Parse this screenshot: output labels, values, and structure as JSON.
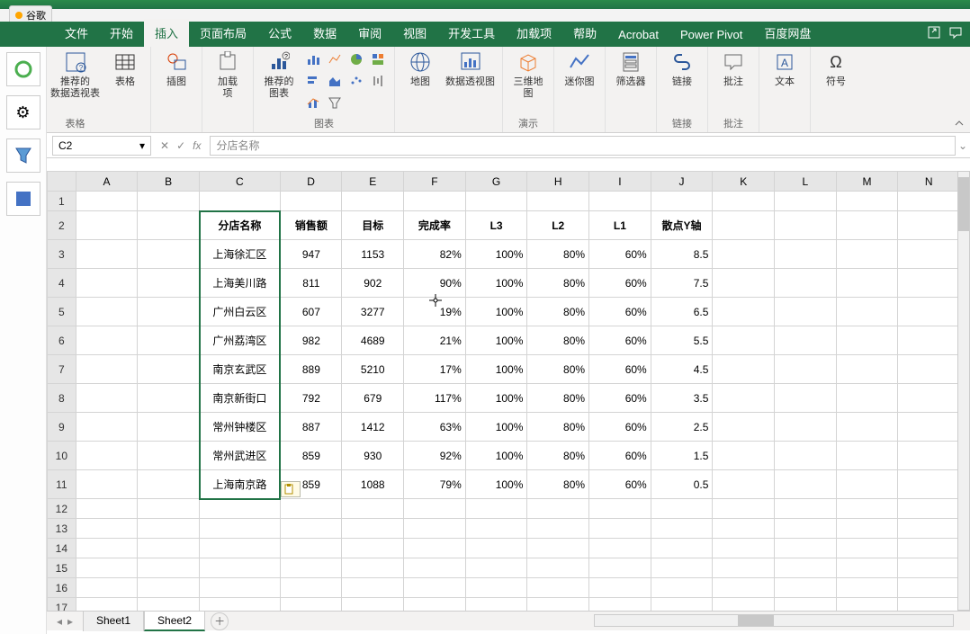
{
  "browser_tab": "谷歌",
  "tabs": [
    "文件",
    "开始",
    "插入",
    "页面布局",
    "公式",
    "数据",
    "审阅",
    "视图",
    "开发工具",
    "加载项",
    "帮助",
    "Acrobat",
    "Power Pivot",
    "百度网盘"
  ],
  "active_tab_index": 2,
  "ribbon": {
    "tables": {
      "pivot": "数据透\n视表",
      "recommend": "推荐的\n数据透视表",
      "table": "表格",
      "group": "表格"
    },
    "illus": {
      "illus": "插图"
    },
    "addins": {
      "addins": "加载\n项"
    },
    "charts": {
      "recommended": "推荐的\n图表",
      "group": "图表"
    },
    "map": {
      "map": "地图",
      "pivotchart": "数据透视图"
    },
    "threed": {
      "label": "三维地\n图",
      "group": "演示"
    },
    "spark": {
      "label": "迷你图"
    },
    "filter": {
      "label": "筛选器"
    },
    "link": {
      "label": "链接",
      "group": "链接"
    },
    "comment": {
      "label": "批注",
      "group": "批注"
    },
    "text": {
      "label": "文本"
    },
    "symbol": {
      "label": "符号"
    }
  },
  "namebox": "C2",
  "formula": "分店名称",
  "columns": [
    "A",
    "B",
    "C",
    "D",
    "E",
    "F",
    "G",
    "H",
    "I",
    "J",
    "K",
    "L",
    "M",
    "N"
  ],
  "headers": {
    "c": "分店名称",
    "d": "销售额",
    "e": "目标",
    "f": "完成率",
    "g": "L3",
    "h": "L2",
    "i": "L1",
    "j": "散点Y轴"
  },
  "rows": [
    {
      "n": "上海徐汇区",
      "d": "947",
      "e": "1153",
      "f": "82%",
      "g": "100%",
      "h": "80%",
      "i": "60%",
      "j": "8.5"
    },
    {
      "n": "上海美川路",
      "d": "811",
      "e": "902",
      "f": "90%",
      "g": "100%",
      "h": "80%",
      "i": "60%",
      "j": "7.5"
    },
    {
      "n": "广州白云区",
      "d": "607",
      "e": "3277",
      "f": "19%",
      "g": "100%",
      "h": "80%",
      "i": "60%",
      "j": "6.5"
    },
    {
      "n": "广州荔湾区",
      "d": "982",
      "e": "4689",
      "f": "21%",
      "g": "100%",
      "h": "80%",
      "i": "60%",
      "j": "5.5"
    },
    {
      "n": "南京玄武区",
      "d": "889",
      "e": "5210",
      "f": "17%",
      "g": "100%",
      "h": "80%",
      "i": "60%",
      "j": "4.5"
    },
    {
      "n": "南京新街口",
      "d": "792",
      "e": "679",
      "f": "117%",
      "g": "100%",
      "h": "80%",
      "i": "60%",
      "j": "3.5"
    },
    {
      "n": "常州钟楼区",
      "d": "887",
      "e": "1412",
      "f": "63%",
      "g": "100%",
      "h": "80%",
      "i": "60%",
      "j": "2.5"
    },
    {
      "n": "常州武进区",
      "d": "859",
      "e": "930",
      "f": "92%",
      "g": "100%",
      "h": "80%",
      "i": "60%",
      "j": "1.5"
    },
    {
      "n": "上海南京路",
      "d": "859",
      "e": "1088",
      "f": "79%",
      "g": "100%",
      "h": "80%",
      "i": "60%",
      "j": "0.5"
    }
  ],
  "sheets": [
    "Sheet1",
    "Sheet2"
  ],
  "active_sheet": 1
}
